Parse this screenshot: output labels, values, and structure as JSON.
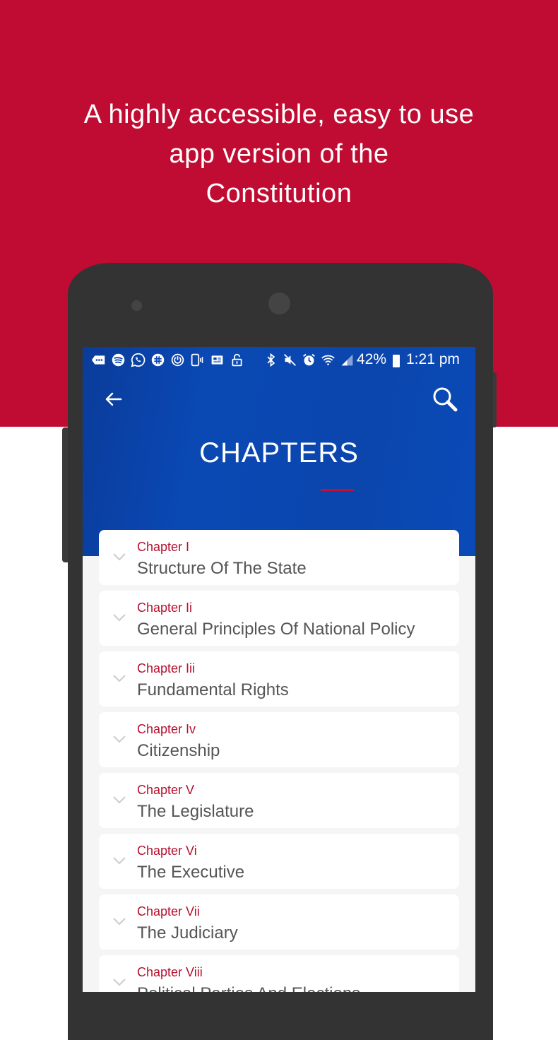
{
  "promo": {
    "headline_lines": [
      "A highly accessible, easy to use",
      "app version of the",
      "Constitution"
    ],
    "background_color": "#c00c32"
  },
  "status_bar": {
    "left_icons": [
      "more-notifications-icon",
      "spotify-icon",
      "whatsapp-icon",
      "slack-icon",
      "sync-icon",
      "phone-vibrate-icon",
      "news-icon",
      "lock-icon"
    ],
    "right_icons": [
      "bluetooth-icon",
      "mute-icon",
      "alarm-icon",
      "wifi-icon",
      "signal-icon"
    ],
    "battery_percent": "42%",
    "time": "1:21 pm"
  },
  "header": {
    "back_icon": "arrow-left-icon",
    "search_icon": "search-icon",
    "title": "CHAPTERS",
    "accent_color": "#c8102e",
    "background_color": "#0a46ad"
  },
  "chapters": [
    {
      "number": "Chapter I",
      "title": "Structure Of The State"
    },
    {
      "number": "Chapter Ii",
      "title": "General Principles Of National Policy"
    },
    {
      "number": "Chapter Iii",
      "title": "Fundamental Rights"
    },
    {
      "number": "Chapter Iv",
      "title": "Citizenship"
    },
    {
      "number": "Chapter V",
      "title": "The Legislature"
    },
    {
      "number": "Chapter Vi",
      "title": "The Executive"
    },
    {
      "number": "Chapter Vii",
      "title": "The Judiciary"
    },
    {
      "number": "Chapter Viii",
      "title": "Political Parties And Elections"
    }
  ]
}
